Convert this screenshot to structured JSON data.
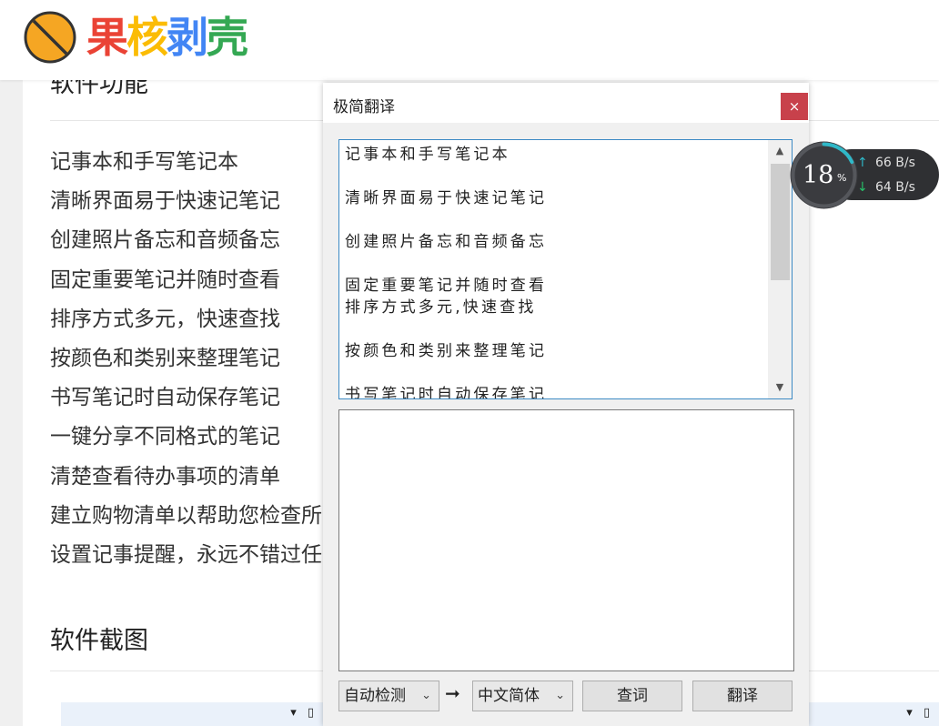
{
  "site": {
    "logo_text": [
      "果",
      "核",
      "剥",
      "壳"
    ]
  },
  "article": {
    "section_title_features": "软件功能",
    "features": [
      "记事本和手写笔记本",
      "清晰界面易于快速记笔记",
      "创建照片备忘和音频备忘",
      "固定重要笔记并随时查看",
      "排序方式多元，快速查找",
      "按颜色和类别来整理笔记",
      "书写笔记时自动保存笔记",
      "一键分享不同格式的笔记",
      "清楚查看待办事项的清单",
      "建立购物清单以帮助您检查所",
      "设置记事提醒，永远不错过任"
    ],
    "section_title_screenshots": "软件截图"
  },
  "translator": {
    "title": "极简翻译",
    "close_label": "×",
    "source_lines": [
      "记事本和手写笔记本",
      "",
      "清晰界面易于快速记笔记",
      "",
      "创建照片备忘和音频备忘",
      "",
      "固定重要笔记并随时查看",
      "排序方式多元,快速查找",
      "",
      "按颜色和类别来整理笔记",
      "",
      "书写笔记时自动保存笔记"
    ],
    "source_language": "自动检测",
    "target_language": "中文简体",
    "arrow": "➞",
    "lookup_button": "查词",
    "translate_button": "翻译",
    "scroll_fraction": 0.0
  },
  "network": {
    "cpu_percent": "18",
    "percent_sign": "%",
    "upload_speed": "66 B/s",
    "download_speed": "64 B/s",
    "gauge_fraction": 0.18,
    "accent_color": "#2fb8c8"
  }
}
